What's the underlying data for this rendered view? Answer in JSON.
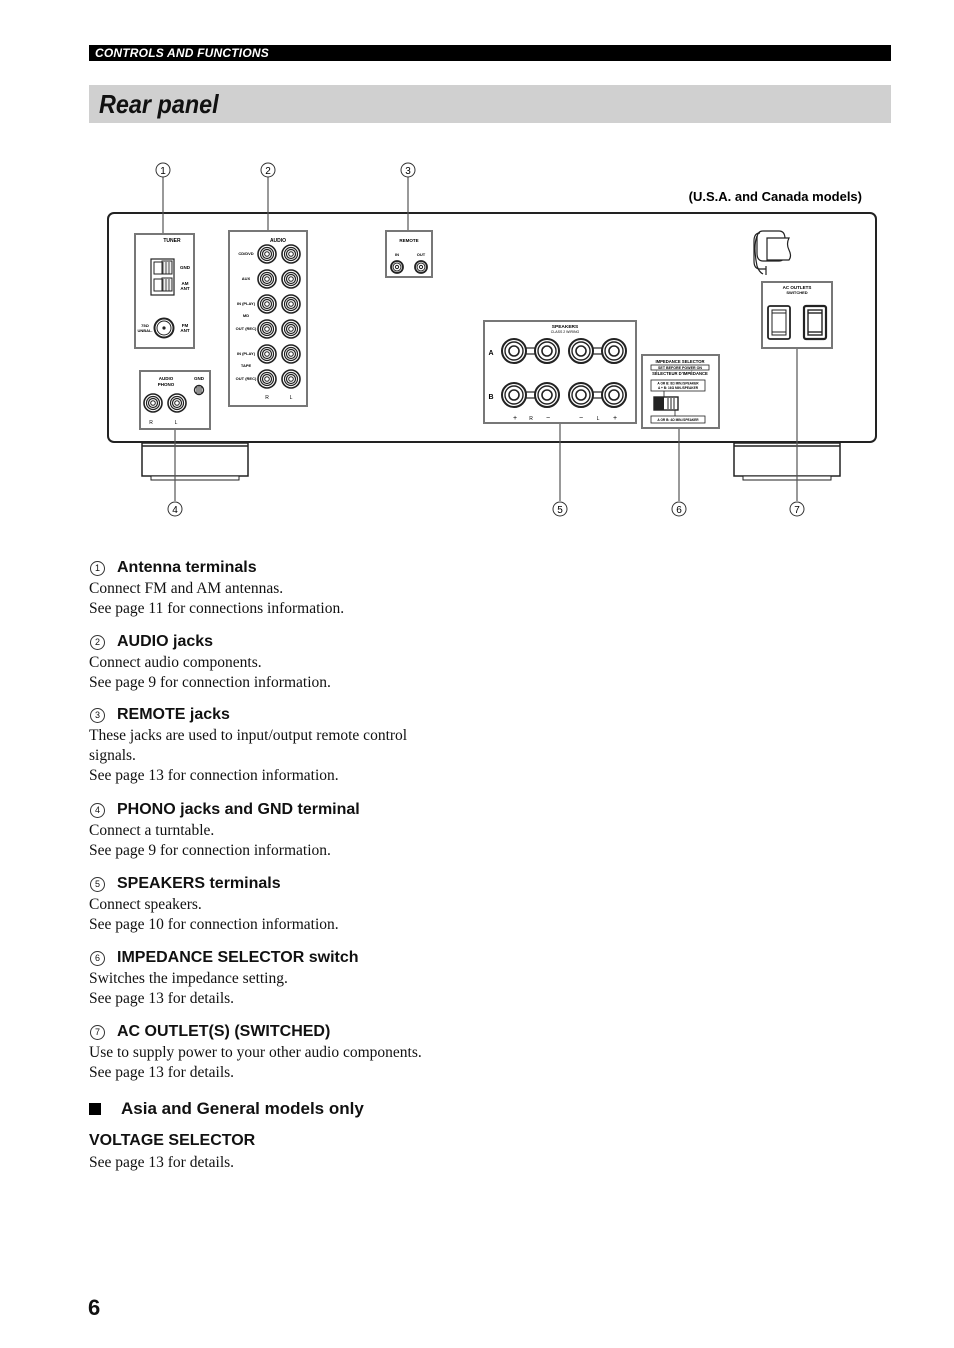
{
  "header": {
    "section": "CONTROLS AND FUNCTIONS",
    "title": "Rear panel"
  },
  "diagram": {
    "model_note": "(U.S.A. and Canada models)",
    "callouts": [
      "1",
      "2",
      "3",
      "4",
      "5",
      "6",
      "7"
    ],
    "tuner": {
      "label": "TUNER",
      "gnd": "GND",
      "am_ant_1": "AM",
      "am_ant_2": "ANT",
      "unbal_1": "75Ω",
      "unbal_2": "UNBAL.",
      "fm_ant_1": "FM",
      "fm_ant_2": "ANT"
    },
    "audio": {
      "label": "AUDIO",
      "rows": [
        "CD/DVD",
        "AUX",
        "IN (PLAY)",
        "OUT (REC)",
        "IN (PLAY)",
        "OUT (REC)"
      ],
      "md": "MD",
      "tape": "TAPE",
      "right": "R",
      "left": "L"
    },
    "remote": {
      "label": "REMOTE",
      "in": "IN",
      "out": "OUT"
    },
    "phono": {
      "label_1": "AUDIO",
      "label_2": "PHONO",
      "gnd": "GND",
      "right": "R",
      "left": "L"
    },
    "speakers": {
      "label": "SPEAKERS",
      "sublabel": "CLASS 2 WIRING",
      "row_a": "A",
      "row_b": "B",
      "polarity": [
        "+",
        "R",
        "−",
        "−",
        "L",
        "+"
      ]
    },
    "impedance": {
      "title": "IMPEDANCE SELECTOR",
      "warning": "SET BEFORE POWER ON",
      "title_fr": "SÉLECTEUR D'IMPÉDANCE",
      "upper_1": "A OR B: 8Ω MIN./SPEAKER",
      "upper_2": "A + B: 16Ω MIN./SPEAKER",
      "lower": "A OR B: 4Ω MIN./SPEAKER"
    },
    "ac_outlets": {
      "label_1": "AC OUTLETS",
      "label_2": "SWITCHED"
    }
  },
  "items": [
    {
      "num": "1",
      "title": "Antenna terminals",
      "lines": [
        "Connect FM and AM antennas.",
        "See page 11 for connections information."
      ]
    },
    {
      "num": "2",
      "title": "AUDIO jacks",
      "lines": [
        "Connect audio components.",
        "See page 9 for connection information."
      ]
    },
    {
      "num": "3",
      "title": "REMOTE jacks",
      "lines": [
        "These jacks are used to input/output remote control",
        "signals.",
        "See page 13 for connection information."
      ]
    },
    {
      "num": "4",
      "title": "PHONO jacks and GND terminal",
      "lines": [
        "Connect a turntable.",
        "See page 9 for connection information."
      ]
    },
    {
      "num": "5",
      "title": "SPEAKERS terminals",
      "lines": [
        "Connect speakers.",
        "See page 10 for connection information."
      ]
    },
    {
      "num": "6",
      "title": "IMPEDANCE SELECTOR switch",
      "lines": [
        "Switches the impedance setting.",
        "See page 13 for details."
      ]
    },
    {
      "num": "7",
      "title": "AC OUTLET(S) (SWITCHED)",
      "lines": [
        "Use to supply power to your other audio components.",
        "See page 13 for details."
      ]
    }
  ],
  "asia": {
    "heading": "Asia and General models only",
    "subheading": "VOLTAGE SELECTOR",
    "body": "See page 13 for details."
  },
  "page_number": "6"
}
